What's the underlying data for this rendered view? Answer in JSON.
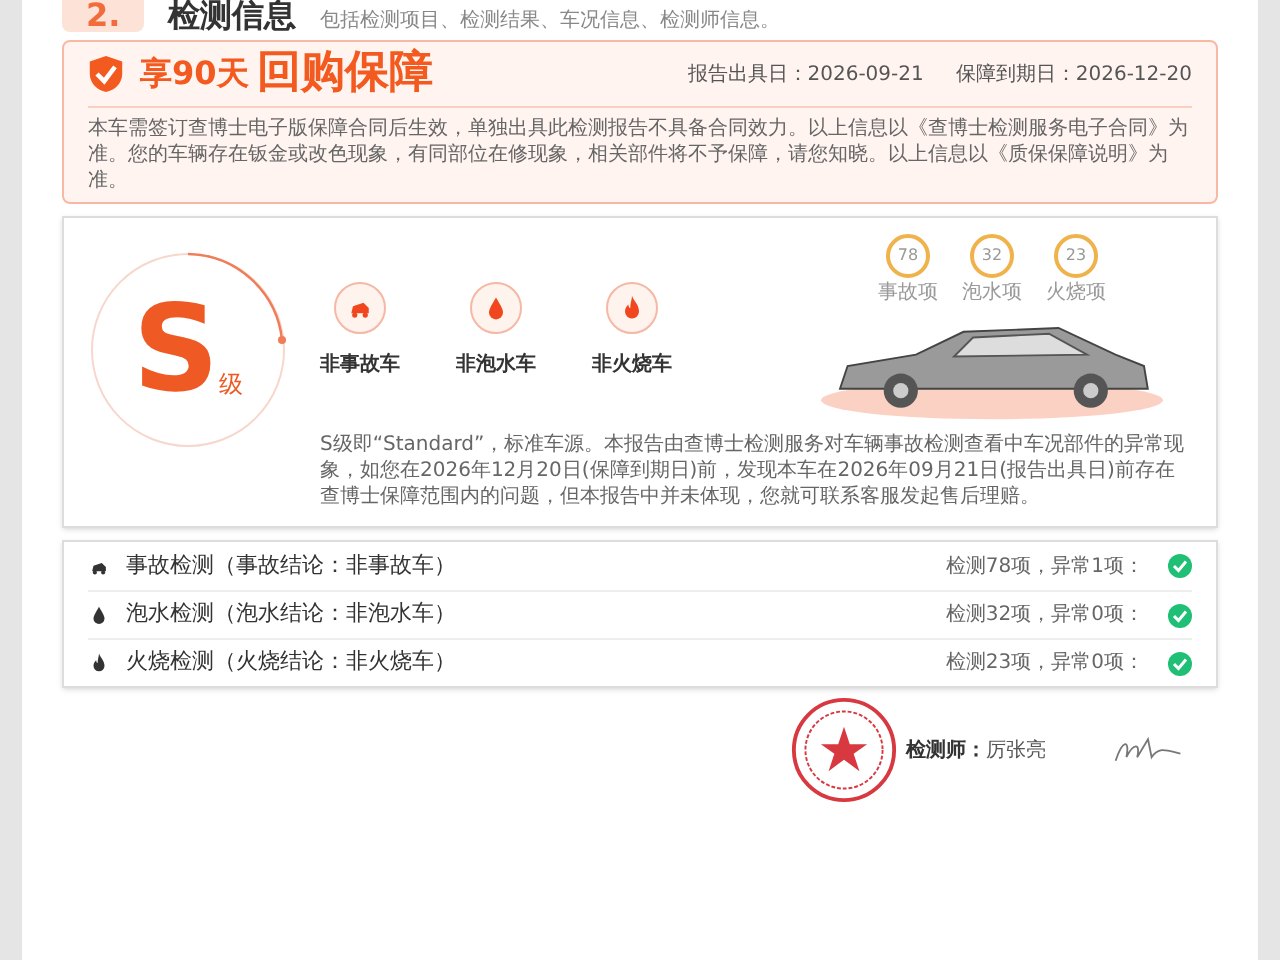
{
  "section": {
    "number": "2.",
    "title": "检测信息",
    "subtitle": "包括检测项目、检测结果、车况信息、检测师信息。"
  },
  "guarantee": {
    "prefix": "享90天",
    "title": "回购保障",
    "report_date": "报告出具日：2026-09-21",
    "expiry_date": "保障到期日：2026-12-20",
    "note": "本车需签订查博士电子版保障合同后生效，单独出具此检测报告不具备合同效力。以上信息以《查博士检测服务电子合同》为准。您的车辆存在钣金或改色现象，有同部位在修现象，相关部件将不予保障，请您知晓。以上信息以《质保保障说明》为准。"
  },
  "grade": {
    "letter": "S",
    "suffix": "级",
    "tags": [
      {
        "kind": "accident",
        "label": "非事故车"
      },
      {
        "kind": "water",
        "label": "非泡水车"
      },
      {
        "kind": "fire",
        "label": "非火烧车"
      }
    ],
    "counts": [
      {
        "value": "78",
        "label": "事故项"
      },
      {
        "value": "32",
        "label": "泡水项"
      },
      {
        "value": "23",
        "label": "火烧项"
      }
    ],
    "description": "S级即“Standard”，标准车源。本报告由查博士检测服务对车辆事故检测查看中车况部件的异常现象，如您在2026年12月20日(保障到期日)前，发现本车在2026年09月21日(报告出具日)前存在查博士保障范围内的问题，但本报告中并未体现，您就可联系客服发起售后理赔。"
  },
  "checks": [
    {
      "kind": "accident",
      "title": "事故检测（事故结论：非事故车）",
      "summary": "检测78项，异常1项：",
      "passed": true
    },
    {
      "kind": "water",
      "title": "泡水检测（泡水结论：非泡水车）",
      "summary": "检测32项，异常0项：",
      "passed": true
    },
    {
      "kind": "fire",
      "title": "火烧检测（火烧结论：非火烧车）",
      "summary": "检测23项，异常0项：",
      "passed": true
    }
  ],
  "inspector": {
    "label": "检测师：",
    "name": "厉张亮"
  }
}
